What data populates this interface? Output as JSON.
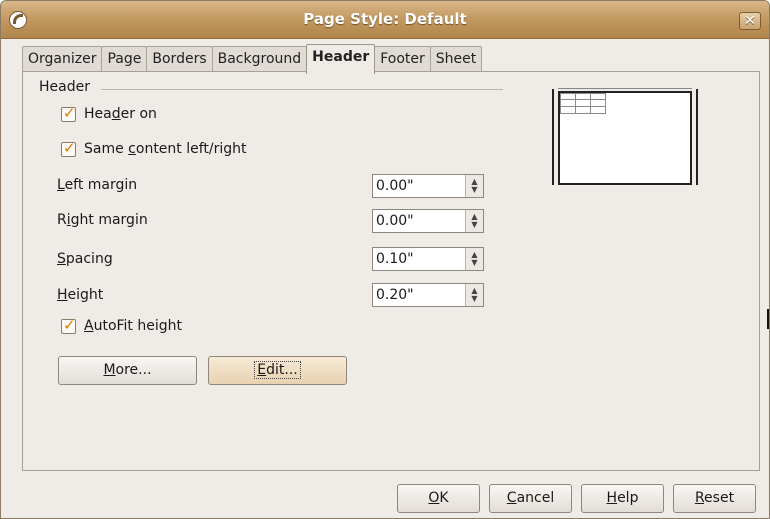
{
  "window": {
    "title": "Page Style: Default",
    "close_label": "✕"
  },
  "tabs": [
    {
      "label": "Organizer"
    },
    {
      "label": "Page"
    },
    {
      "label": "Borders"
    },
    {
      "label": "Background"
    },
    {
      "label": "Header",
      "active": true
    },
    {
      "label": "Footer"
    },
    {
      "label": "Sheet"
    }
  ],
  "header_section": {
    "title": "Header",
    "header_on": {
      "pre": "Hea",
      "mnemonic": "d",
      "post": "er on",
      "checked": true
    },
    "same_content": {
      "pre": "Same ",
      "mnemonic": "c",
      "post": "ontent left/right",
      "checked": true
    },
    "left_margin": {
      "mnemonic": "L",
      "post": "eft margin",
      "value": "0.00\""
    },
    "right_margin": {
      "pre": "R",
      "mnemonic": "i",
      "post": "ght margin",
      "value": "0.00\""
    },
    "spacing": {
      "mnemonic": "S",
      "post": "pacing",
      "value": "0.10\""
    },
    "height": {
      "mnemonic": "H",
      "post": "eight",
      "value": "0.20\""
    },
    "autofit": {
      "mnemonic": "A",
      "post": "utoFit height",
      "checked": true
    },
    "more_button": {
      "mnemonic": "M",
      "post": "ore..."
    },
    "edit_button": {
      "mnemonic": "E",
      "post": "dit..."
    }
  },
  "footer_buttons": {
    "ok": {
      "mnemonic": "O",
      "post": "K"
    },
    "cancel": {
      "mnemonic": "C",
      "post": "ancel"
    },
    "help": {
      "mnemonic": "H",
      "post": "elp"
    },
    "reset": {
      "mnemonic": "R",
      "post": "eset"
    }
  },
  "colors": {
    "titlebar": "#c39a62",
    "dialog_bg": "#efebe7",
    "check_accent": "#e07a00"
  }
}
